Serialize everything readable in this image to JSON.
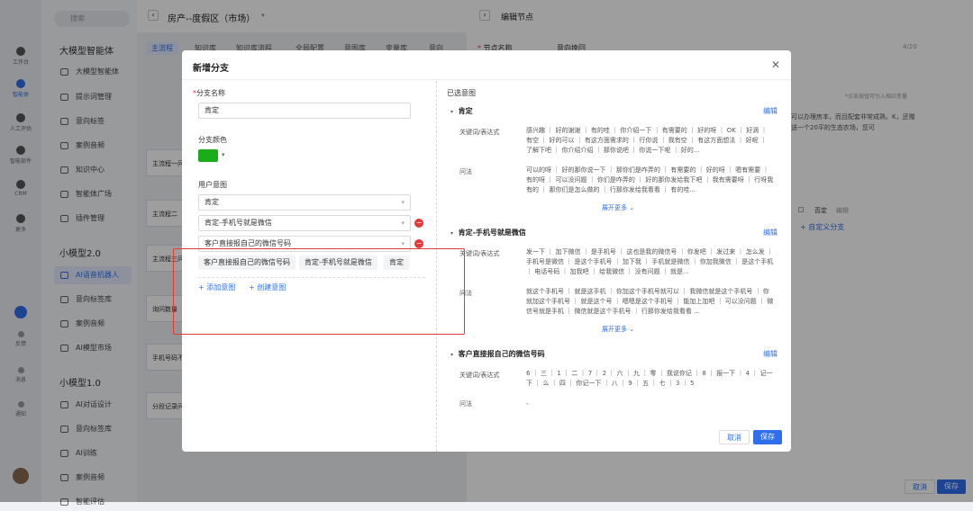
{
  "sidebar": {
    "search_placeholder": "搜索",
    "rail": [
      {
        "label": "工作台",
        "icon": "workbench-icon"
      },
      {
        "label": "智能体",
        "icon": "agent-icon",
        "active": true
      },
      {
        "label": "人工评估",
        "icon": "evaluate-icon"
      },
      {
        "label": "智能部件",
        "icon": "component-icon"
      },
      {
        "label": "CRM",
        "icon": "crm-icon"
      },
      {
        "label": "更多",
        "icon": "more-icon"
      }
    ],
    "rail_bottom": [
      "反馈",
      "消息",
      "通知"
    ],
    "sections": [
      {
        "title": "大模型智能体",
        "items": [
          "大模型智能体",
          "提示词管理",
          "意向标签",
          "案例音频",
          "知识中心",
          "智能体广场",
          "插件管理"
        ]
      },
      {
        "title": "小模型2.0",
        "items": [
          "AI语音机器人",
          "意向标签库",
          "案例音频",
          "AI模型市场"
        ]
      },
      {
        "title": "小模型1.0",
        "items": [
          "AI对话设计",
          "意向标签库",
          "AI训练",
          "案例音频",
          "智能评估"
        ]
      }
    ]
  },
  "canvas": {
    "title": "房产--度假区（市场）",
    "tabs": [
      "主流程",
      "知识库",
      "知识库流程",
      "全局配置",
      "意图库",
      "变量库",
      "意向"
    ],
    "nodes": [
      "主流程一问",
      "主流程二",
      "主流程三问",
      "询问数量",
      "手机号码不",
      "分段记录问"
    ]
  },
  "right_panel": {
    "title": "编辑节点",
    "node_name_label": "节点名称",
    "node_name_value": "意向挽回",
    "node_name_count": "4/20",
    "hint": "*点击按钮可引入相应变量",
    "text": "可以办理房本，而且配套非常成熟。K，还赠送一个20平的生态农场，您可",
    "deny_label": "否定",
    "edit_label": "编辑",
    "add_branch": "+ 自定义分支",
    "cancel": "取消",
    "save": "保存"
  },
  "modal": {
    "title": "新增分支",
    "branch_name_label": "分支名称",
    "branch_name_value": "肯定",
    "branch_color_label": "分支颜色",
    "branch_color": "#1aad19",
    "user_intent_label": "用户意图",
    "intents": [
      "肯定",
      "肯定-手机号就是微信",
      "客户直接报自己的微信号码"
    ],
    "chips": [
      "客户直接报自己的微信号码",
      "肯定-手机号就是微信",
      "肯定"
    ],
    "add_intent": "+ 添加意图",
    "create_intent": "+ 创建意图",
    "selected_title": "已选意图",
    "edit": "编辑",
    "expand_more": "展开更多",
    "keyword_label": "关键词/表达式",
    "question_label": "问法",
    "groups": [
      {
        "name": "肯定",
        "keywords": "感兴趣 ｜ 好的谢谢 ｜ 有的哇 ｜ 你介绍一下 ｜ 有需要的 ｜ 好的呀 ｜ OK ｜ 好滴 ｜ 有空 ｜ 好的可以 ｜ 有这方面需求的 ｜ 行你说 ｜ 我有空 ｜ 有这方面想法 ｜ 好呢 ｜ 了解下吧 ｜ 你介绍介绍 ｜ 那你说吧 ｜ 你说一下呢 ｜ 好的...",
        "questions": "可以的呀 ｜ 好的那你说一下 ｜ 那你们是咋弄的 ｜ 有需要的 ｜ 好的呀 ｜ 嗯有需要 ｜ 有的呀 ｜ 可以没问题 ｜ 你们是咋弄的 ｜ 好的那你发给我下吧 ｜ 我有需要呀 ｜ 行呀我有的 ｜ 那你们是怎么做的 ｜ 行那你发给我看看 ｜ 有的哇..."
      },
      {
        "name": "肯定-手机号就是微信",
        "keywords": "发一下 ｜ 加下微信 ｜ 是手机号 ｜ 这也是我的微信号 ｜ 你发吧 ｜ 发过来 ｜ 怎么发 ｜ 手机号是微信 ｜ 是这个手机号 ｜ 加下我 ｜ 手机就是微信 ｜ 你加我微信 ｜ 是这个手机 ｜ 电话号码 ｜ 加我吧 ｜ 给我微信 ｜ 没有问题 ｜ 就是...",
        "questions": "就这个手机号 ｜ 就是这手机 ｜ 你加这个手机号就可以 ｜ 我微信就是这个手机号 ｜ 你就加这个手机号 ｜ 就是这个号 ｜ 嗯嗯是这个手机号 ｜ 能加上加吧 ｜ 可以没问题 ｜ 微信号就是手机 ｜ 微信就是这个手机号 ｜ 行那你发给我看看 ..."
      },
      {
        "name": "客户直接报自己的微信号码",
        "keywords": "6 ｜ 三 ｜ 1 ｜ 二 ｜ 7 ｜ 2 ｜ 六 ｜ 九 ｜ 零 ｜ 我说你记 ｜ 8 ｜ 报一下 ｜ 4 ｜ 记一下 ｜ 么 ｜ 四 ｜ 你记一下 ｜ 八 ｜ 9 ｜ 五 ｜ 七 ｜ 3 ｜ 5",
        "questions": "-"
      }
    ],
    "cancel": "取消",
    "save": "保存"
  }
}
